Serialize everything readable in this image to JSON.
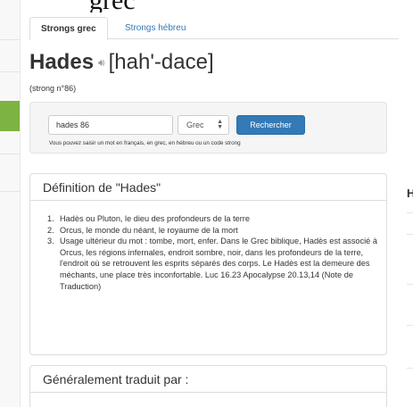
{
  "top_partial_text": "grec",
  "tabs": [
    {
      "label": "Strongs grec",
      "active": true
    },
    {
      "label": "Strongs hébreu",
      "active": false
    }
  ],
  "header": {
    "word": "Hades",
    "phonetic": "[hah'-dace]",
    "strong_number": "(strong n°86)"
  },
  "search": {
    "input_value": "hades 86",
    "language_selected": "Grec",
    "button_label": "Rechercher",
    "help_text": "Vous pouvez saisir un mot en français, en grec, en hébreu ou un code strong"
  },
  "definition": {
    "title": "Définition de \"Hades\"",
    "items": [
      {
        "num": "1.",
        "text": "Hadès ou Pluton, le dieu des profondeurs de la terre"
      },
      {
        "num": "2.",
        "text": "Orcus, le monde du néant, le royaume de la mort"
      },
      {
        "num": "3.",
        "text": "Usage ultérieur du mot : tombe, mort, enfer. Dans le Grec biblique, Hadès est associé à Orcus, les régions infernales, endroit sombre, noir, dans les profondeurs de la terre, l'endroit où se retrouvent les esprits séparés des corps. Le Hadès est la demeure des méchants, une place très inconfortable. Luc 16.23 Apocalypse 20.13,14 (Note de Traduction)"
      }
    ]
  },
  "translated": {
    "title": "Généralement traduit par :"
  },
  "right_partial_heading": "H",
  "colors": {
    "link": "#337ab7",
    "primary_button": "#337ab7",
    "sidebar_accent": "#7cb342",
    "panel_border": "#dddddd",
    "well_background": "#f5f5f5"
  },
  "icons": {
    "pronunciation": "speaker-icon",
    "select": "select-arrows-icon"
  }
}
